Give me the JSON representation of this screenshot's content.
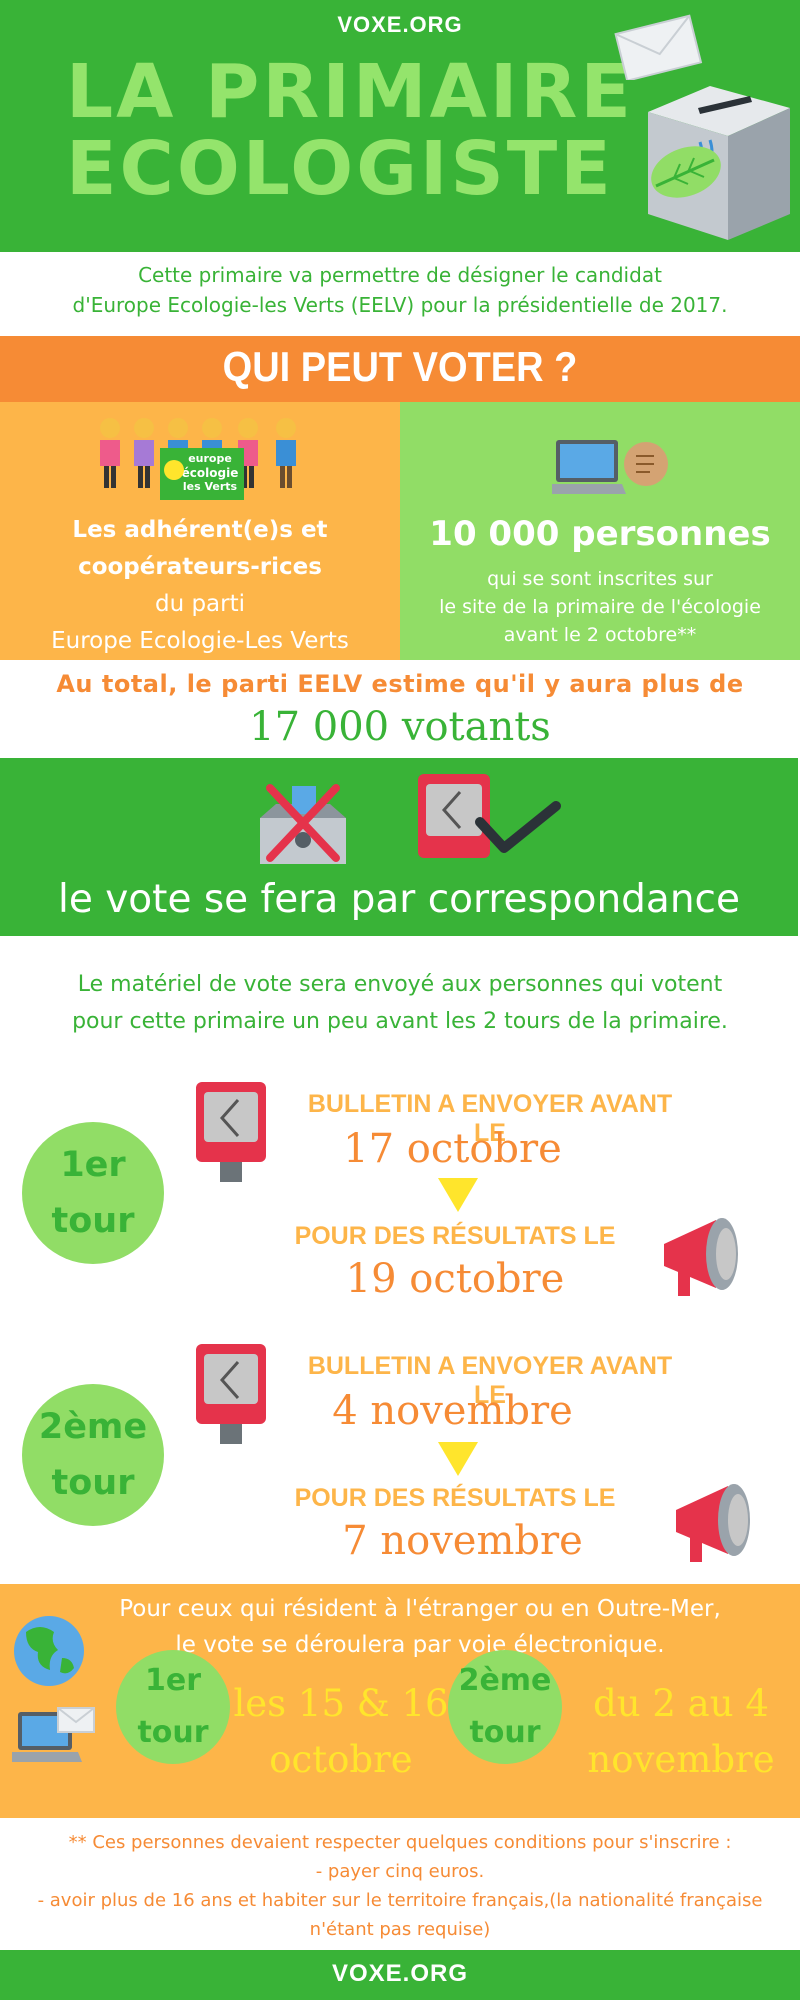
{
  "header": {
    "site": "VOXE.ORG",
    "title_line1": "LA PRIMAIRE",
    "title_line2": "ECOLOGISTE",
    "bg_color": "#39b337"
  },
  "intro": {
    "line1": "Cette primaire va permettre de désigner le candidat",
    "line2": "d'Europe Ecologie-les Verts (EELV) pour la présidentielle de 2017."
  },
  "who": {
    "title": "QUI PEUT VOTER ?",
    "left": {
      "bold_line1": "Les adhérent(e)s et",
      "bold_line2": "coopérateurs-rices",
      "line3": "du parti",
      "line4": "Europe Ecologie-Les Verts",
      "logo_line1": "europe",
      "logo_line2": "écologie",
      "logo_line3": "les Verts"
    },
    "right": {
      "big": "10 000 personnes",
      "line1": "qui se sont inscrites sur",
      "line2": "le site de la primaire de l'écologie",
      "line3": "avant le 2 octobre**"
    }
  },
  "total": {
    "line": "Au total, le parti EELV estime qu'il y aura plus de",
    "number": "17 000 votants"
  },
  "method": {
    "text": "le vote se fera par correspondance",
    "materiel_line1": "Le matériel de vote sera envoyé aux personnes qui votent",
    "materiel_line2": "pour cette primaire un peu avant les 2 tours de la primaire."
  },
  "tours": [
    {
      "badge_line1": "1er",
      "badge_line2": "tour",
      "send_label": "BULLETIN A ENVOYER AVANT LE",
      "send_date": "17 octobre",
      "result_label": "POUR DES RÉSULTATS LE",
      "result_date": "19 octobre"
    },
    {
      "badge_line1": "2ème",
      "badge_line2": "tour",
      "send_label": "BULLETIN A ENVOYER AVANT LE",
      "send_date": "4 novembre",
      "result_label": "POUR DES RÉSULTATS LE",
      "result_date": "7 novembre"
    }
  ],
  "abroad": {
    "line1": "Pour ceux qui résident à l'étranger ou en Outre-Mer,",
    "line2": "le vote se déroulera par voie électronique.",
    "tour1": {
      "badge_line1": "1er",
      "badge_line2": "tour",
      "date_line1": "les 15 & 16",
      "date_line2": "octobre"
    },
    "tour2": {
      "badge_line1": "2ème",
      "badge_line2": "tour",
      "date_line1": "du 2 au 4",
      "date_line2": "novembre"
    }
  },
  "footnote": {
    "line1": "** Ces personnes devaient respecter quelques conditions pour s'inscrire :",
    "line2": "- payer cinq euros.",
    "line3": "- avoir plus de 16 ans et habiter sur le territoire français,(la nationalité française",
    "line4": "n'étant pas requise)"
  },
  "footer": {
    "site": "VOXE.ORG"
  },
  "icons": [
    "envelope-icon",
    "ballot-box-icon",
    "leaf-icon",
    "people-icon",
    "laptop-icon",
    "fist-icon",
    "crossed-ballot-box-icon",
    "mailbox-icon",
    "check-icon",
    "megaphone-icon",
    "globe-icon",
    "laptop-mail-icon"
  ]
}
